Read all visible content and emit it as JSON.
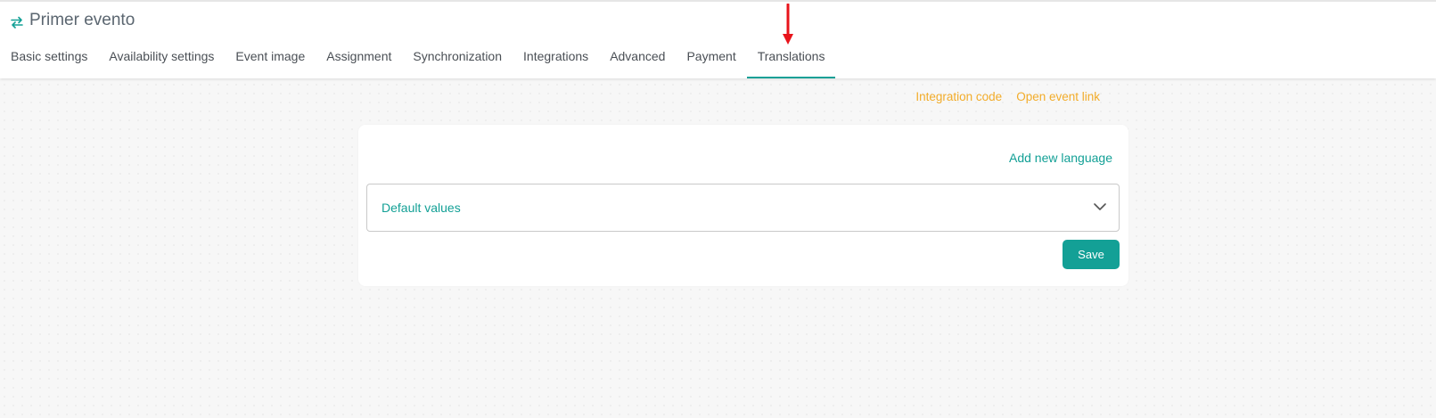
{
  "header": {
    "title": "Primer evento",
    "title_icon": "swap-arrows-icon"
  },
  "tabs": [
    {
      "label": "Basic settings",
      "active": false
    },
    {
      "label": "Availability settings",
      "active": false
    },
    {
      "label": "Event image",
      "active": false
    },
    {
      "label": "Assignment",
      "active": false
    },
    {
      "label": "Synchronization",
      "active": false
    },
    {
      "label": "Integrations",
      "active": false
    },
    {
      "label": "Advanced",
      "active": false
    },
    {
      "label": "Payment",
      "active": false
    },
    {
      "label": "Translations",
      "active": true
    }
  ],
  "links": {
    "integration_code": "Integration code",
    "open_event_link": "Open event link"
  },
  "card": {
    "add_language": "Add new language",
    "accordion_label": "Default values",
    "save_label": "Save"
  },
  "colors": {
    "accent": "#13a096",
    "link_orange": "#f2ac2a",
    "annotation_arrow": "#e8141b"
  }
}
